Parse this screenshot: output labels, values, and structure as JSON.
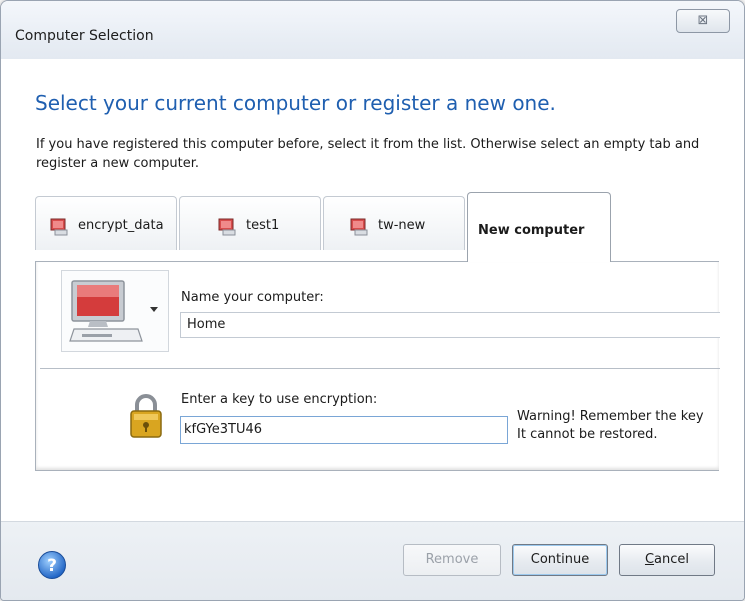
{
  "window": {
    "title": "Computer Selection",
    "close_glyph": "⊠"
  },
  "content": {
    "heading": "Select your current computer or register a new one.",
    "intro": "If you have registered this computer before, select it from the list. Otherwise select an empty tab and register a new computer."
  },
  "tabs": [
    {
      "label": "encrypt_data",
      "icon": "computer-icon",
      "active": false
    },
    {
      "label": "test1",
      "icon": "computer-icon",
      "active": false
    },
    {
      "label": "tw-new",
      "icon": "computer-icon",
      "active": false
    },
    {
      "label": "New computer",
      "active": true
    }
  ],
  "form": {
    "computer_picker_icon": "computer-icon",
    "name_label": "Name your computer:",
    "name_value": "Home",
    "key_label": "Enter a key to use encryption:",
    "key_value": "kfGYe3TU46",
    "lock_icon": "padlock-icon",
    "warning_line1": "Warning! Remember the key",
    "warning_line2": "It cannot be restored."
  },
  "footer": {
    "help_icon": "help-icon",
    "remove_label": "Remove",
    "continue_label": "Continue",
    "cancel_label_first": "C",
    "cancel_label_rest": "ancel"
  },
  "colors": {
    "heading": "#1f5fb0",
    "footer_bg": "#e9eef3",
    "input_focus_border": "#7aa6d6"
  }
}
